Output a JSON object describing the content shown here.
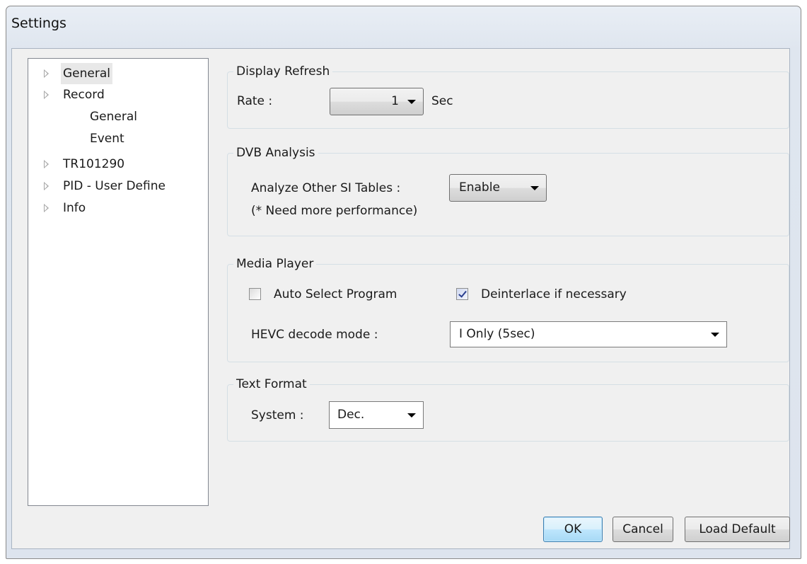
{
  "window": {
    "title": "Settings"
  },
  "tree": {
    "items": [
      {
        "label": "General"
      },
      {
        "label": "Record"
      },
      {
        "label": "General"
      },
      {
        "label": "Event"
      },
      {
        "label": "TR101290"
      },
      {
        "label": "PID - User Define"
      },
      {
        "label": "Info"
      }
    ]
  },
  "display_refresh": {
    "title": "Display Refresh",
    "rate_label": "Rate :",
    "rate_value": "1",
    "unit": "Sec"
  },
  "dvb_analysis": {
    "title": "DVB Analysis",
    "label": "Analyze Other SI Tables :",
    "note": "(* Need more performance)",
    "value": "Enable"
  },
  "media_player": {
    "title": "Media Player",
    "auto_select_label": "Auto Select Program",
    "auto_select_checked": false,
    "deinterlace_label": "Deinterlace if necessary",
    "deinterlace_checked": true,
    "hevc_label": "HEVC decode mode :",
    "hevc_value": "I Only (5sec)"
  },
  "text_format": {
    "title": "Text Format",
    "system_label": "System :",
    "system_value": "Dec."
  },
  "buttons": {
    "ok": "OK",
    "cancel": "Cancel",
    "load_default": "Load Default"
  }
}
